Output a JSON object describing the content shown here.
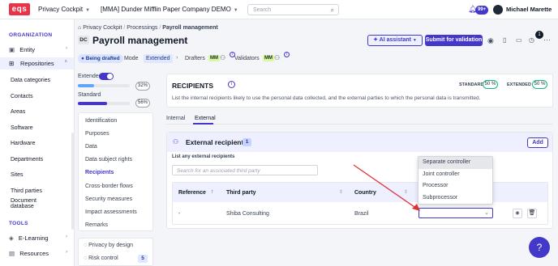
{
  "topbar": {
    "logo": "eqs",
    "product": "Privacy Cockpit",
    "company": "[MMA] Dunder Mifflin Paper Company DEMO",
    "search_placeholder": "Search",
    "notifications_count": "99+",
    "user_name": "Michael Marette"
  },
  "sidebar": {
    "organization_title": "ORGANIZATION",
    "entity": "Entity",
    "repositories": "Repositories",
    "repo_items": [
      "Data categories",
      "Contacts",
      "Areas",
      "Software",
      "Hardware",
      "Departments",
      "Sites",
      "Third parties"
    ],
    "document_database_line1": "Document",
    "document_database_line2": "database",
    "tools_title": "TOOLS",
    "elearning": "E-Learning",
    "resources": "Resources"
  },
  "breadcrumb": [
    "Privacy Cockpit",
    "Processings",
    "Payroll management"
  ],
  "page": {
    "initials": "DC",
    "title": "Payroll management",
    "status": "Being drafted",
    "mode_label": "Mode",
    "mode_value": "Extended",
    "drafters_label": "Drafters",
    "validators_label": "Validators",
    "drafter_initials": "MM",
    "validator_initials": "MM",
    "ai_button": "AI assistant",
    "submit_button": "Submit for validation",
    "pending_count": "1"
  },
  "progress": {
    "extended_label": "Extended",
    "extended_pct": "32%",
    "extended_value": 0.32,
    "standard_label": "Standard",
    "standard_pct": "56%",
    "standard_value": 0.56
  },
  "steps": [
    "Identification",
    "Purposes",
    "Data",
    "Data subject rights",
    "Recipients",
    "Cross-border flows",
    "Security measures",
    "Impact assessments",
    "Remarks"
  ],
  "active_step": "Recipients",
  "side_extra": {
    "privacy_by_design": "Privacy by design",
    "risk_control": "Risk control",
    "risk_count": "5"
  },
  "recipients": {
    "title": "RECIPIENTS",
    "description": "List the internal recipients likely to use the personal data collected, and the external parties to which the personal data is transmitted.",
    "standard_label": "STANDARD",
    "standard_pct": "50 %",
    "extended_label": "EXTENDED",
    "extended_pct": "50 %",
    "tabs": [
      "Internal",
      "External"
    ],
    "active_tab": "External"
  },
  "external": {
    "title": "External recipients",
    "count": "1",
    "add_button": "Add",
    "list_label": "List any external recipients",
    "search_placeholder": "Search for an associated third party",
    "columns": [
      "Reference",
      "Third party",
      "Country"
    ],
    "rows": [
      {
        "reference": "-",
        "third_party": "Shiba Consulting",
        "country": "Brazil"
      }
    ]
  },
  "dropdown": {
    "options": [
      "Separate controller",
      "Joint controller",
      "Processor",
      "Subprocessor"
    ],
    "highlighted": "Separate controller",
    "selected_value": ""
  },
  "colors": {
    "accent": "#4338ca",
    "brand": "#e8334a",
    "annotation_arrow": "#e03131"
  }
}
